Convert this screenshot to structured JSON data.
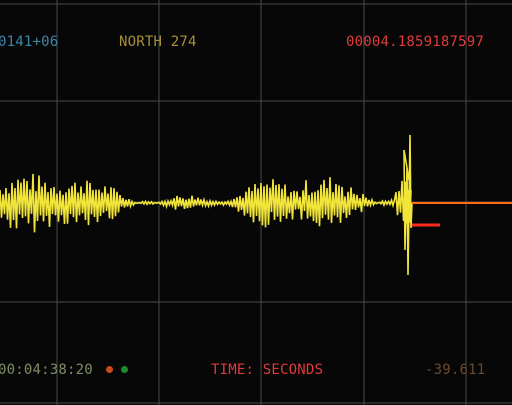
{
  "header": {
    "left_value": "0141+06",
    "channel_label": "NORTH 274",
    "right_value": "00004.1859187597"
  },
  "footer": {
    "timestamp": "00:04:38:20",
    "axis_label": "TIME: SECONDS",
    "right_value": "-39.611"
  },
  "colors": {
    "background": "#070707",
    "grid": "#4a4a4a",
    "trace": "#f2e53a",
    "marker": "#ff6a1a",
    "marker_short": "#ff2a1a",
    "text_teal": "#3f87a8",
    "text_gold": "#a8903a",
    "text_red": "#e03b3b",
    "text_green_gray": "#7d8d66",
    "text_brown": "#6d4a2d",
    "dot_orange": "#c84a1a",
    "dot_green": "#1f8a2a"
  },
  "indicators": [
    {
      "name": "status-dot-orange",
      "color": "#c84a1a"
    },
    {
      "name": "status-dot-green",
      "color": "#1f8a2a"
    }
  ]
}
